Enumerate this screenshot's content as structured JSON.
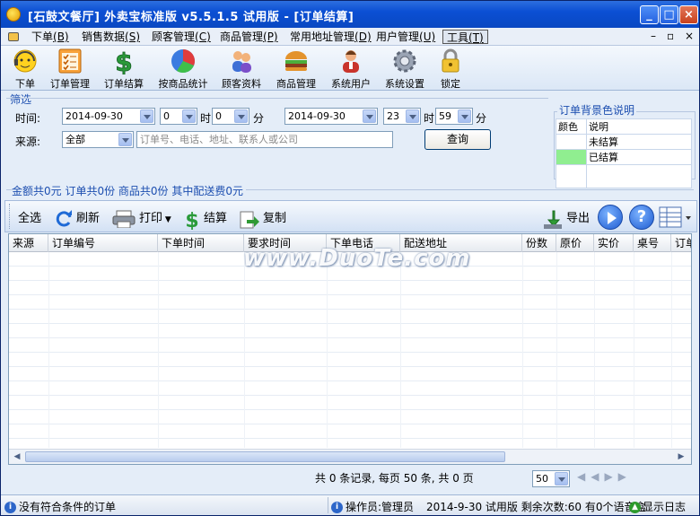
{
  "window": {
    "title": "[石鼓文餐厅] 外卖宝标准版 v5.5.1.5 试用版 - [订单结算]"
  },
  "menu": {
    "items": [
      {
        "label": "下单",
        "key": "(B)"
      },
      {
        "label": "销售数据",
        "key": "(S)"
      },
      {
        "label": "顾客管理",
        "key": "(C)"
      },
      {
        "label": "商品管理",
        "key": "(P)"
      },
      {
        "label": "常用地址管理",
        "key": "(D)"
      },
      {
        "label": "用户管理",
        "key": "(U)"
      },
      {
        "label": "工具",
        "key": "(T)"
      }
    ]
  },
  "toolbar": {
    "items": [
      {
        "label": "下单",
        "icon": "person-headset-icon"
      },
      {
        "label": "订单管理",
        "icon": "checklist-icon"
      },
      {
        "label": "订单结算",
        "icon": "dollar-icon"
      },
      {
        "label": "按商品统计",
        "icon": "pie-chart-icon"
      },
      {
        "label": "顾客资料",
        "icon": "users-icon"
      },
      {
        "label": "商品管理",
        "icon": "burger-icon"
      },
      {
        "label": "系统用户",
        "icon": "user-admin-icon"
      },
      {
        "label": "系统设置",
        "icon": "gear-icon"
      },
      {
        "label": "锁定",
        "icon": "lock-icon"
      }
    ]
  },
  "filter": {
    "group_label": "筛选",
    "time_label": "时间:",
    "start_date": "2014-09-30",
    "start_hour": "0",
    "hour_unit": "时",
    "start_minute": "0",
    "minute_unit": "分",
    "end_date": "2014-09-30",
    "end_hour": "23",
    "end_minute": "59",
    "source_label": "来源:",
    "source_value": "全部",
    "search_placeholder": "订单号、电话、地址、联系人或公司",
    "query_button": "查询"
  },
  "legend": {
    "title": "订单背景色说明",
    "col_color": "颜色",
    "col_desc": "说明",
    "rows": [
      {
        "desc": "未结算",
        "color": "#ffffff"
      },
      {
        "desc": "已结算",
        "color": "#90ee90"
      }
    ]
  },
  "summary": "金额共0元 订单共0份 商品共0份 其中配送费0元",
  "actions": {
    "select_all": "全选",
    "refresh": "刷新",
    "print": "打印",
    "settle": "结算",
    "copy": "复制",
    "export": "导出"
  },
  "grid": {
    "columns": [
      "来源",
      "订单编号",
      "下单时间",
      "要求时间",
      "下单电话",
      "配送地址",
      "份数",
      "原价",
      "实价",
      "桌号",
      "订单"
    ]
  },
  "watermark": "www.DuoTe.com",
  "pager": {
    "text": "共 0 条记录, 每页 50 条, 共 0 页",
    "page_size": "50"
  },
  "status": {
    "message": "没有符合条件的订单",
    "operator": "操作员:管理员",
    "info": "2014-9-30 试用版 剩余次数:60 有0个语音盒",
    "log": "显示日志"
  },
  "colors": {
    "titlebar": "#0b4fd4",
    "accent": "#1d4fb0",
    "settled": "#90ee90"
  }
}
